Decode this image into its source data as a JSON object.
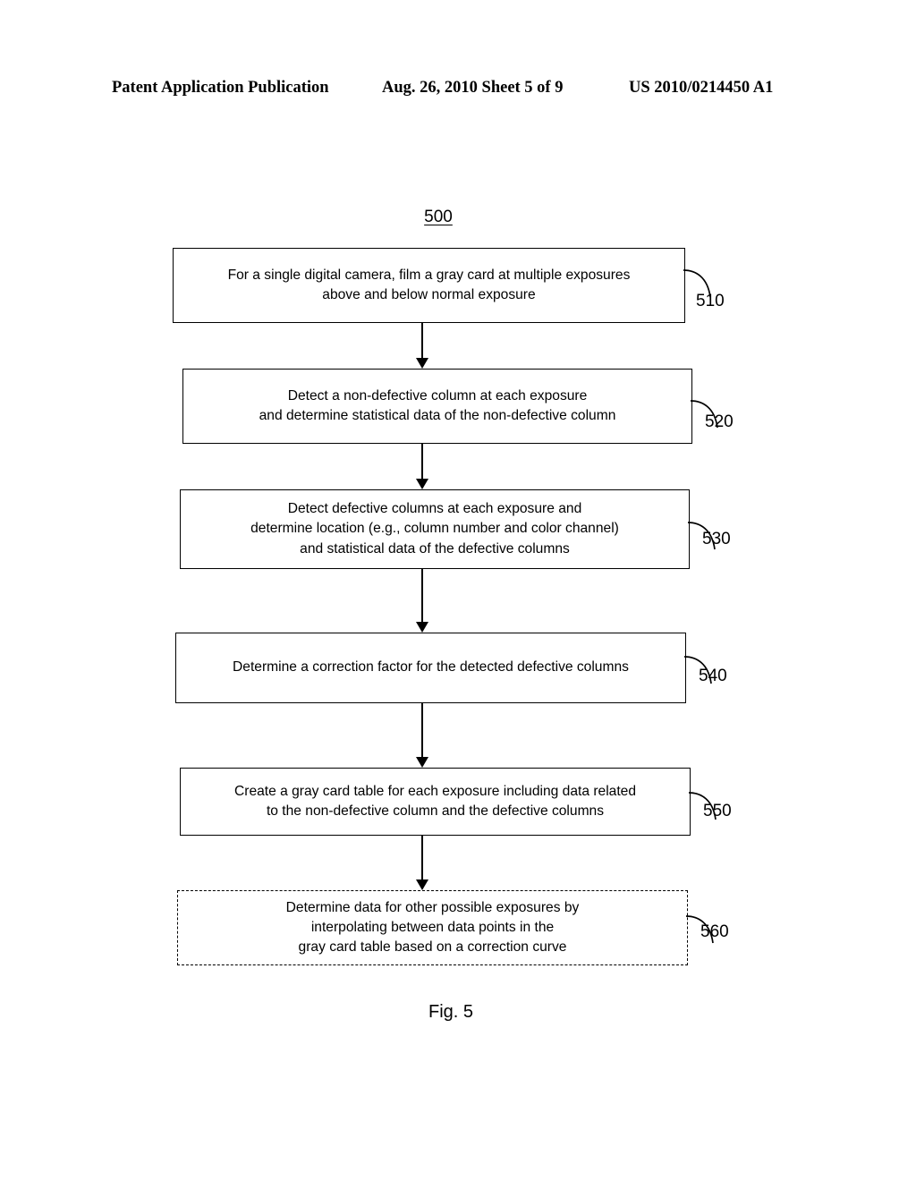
{
  "header": {
    "left": "Patent Application Publication",
    "middle": "Aug. 26, 2010  Sheet 5 of 9",
    "right": "US 2010/0214450 A1"
  },
  "figure": {
    "reference_number": "500",
    "caption": "Fig. 5",
    "colors": {
      "stroke": "#000000",
      "background": "#ffffff"
    }
  },
  "steps": [
    {
      "id": "510",
      "label": "510",
      "border": "solid",
      "text": "For a single digital camera, film a gray card at multiple exposures\nabove and below normal exposure"
    },
    {
      "id": "520",
      "label": "520",
      "border": "solid",
      "text": "Detect a non-defective column at each exposure\nand determine statistical data of the non-defective column"
    },
    {
      "id": "530",
      "label": "530",
      "border": "solid",
      "text": "Detect defective columns at each exposure and\ndetermine location (e.g., column number and color channel)\nand statistical data of the defective columns"
    },
    {
      "id": "540",
      "label": "540",
      "border": "solid",
      "text": "Determine a correction factor for the detected defective columns"
    },
    {
      "id": "550",
      "label": "550",
      "border": "solid",
      "text": "Create a gray card table for each exposure including data related\nto the non-defective column and the defective columns"
    },
    {
      "id": "560",
      "label": "560",
      "border": "dashed",
      "text": "Determine data for other possible exposures by\ninterpolating between data points in the\ngray card table based on a correction curve"
    }
  ]
}
